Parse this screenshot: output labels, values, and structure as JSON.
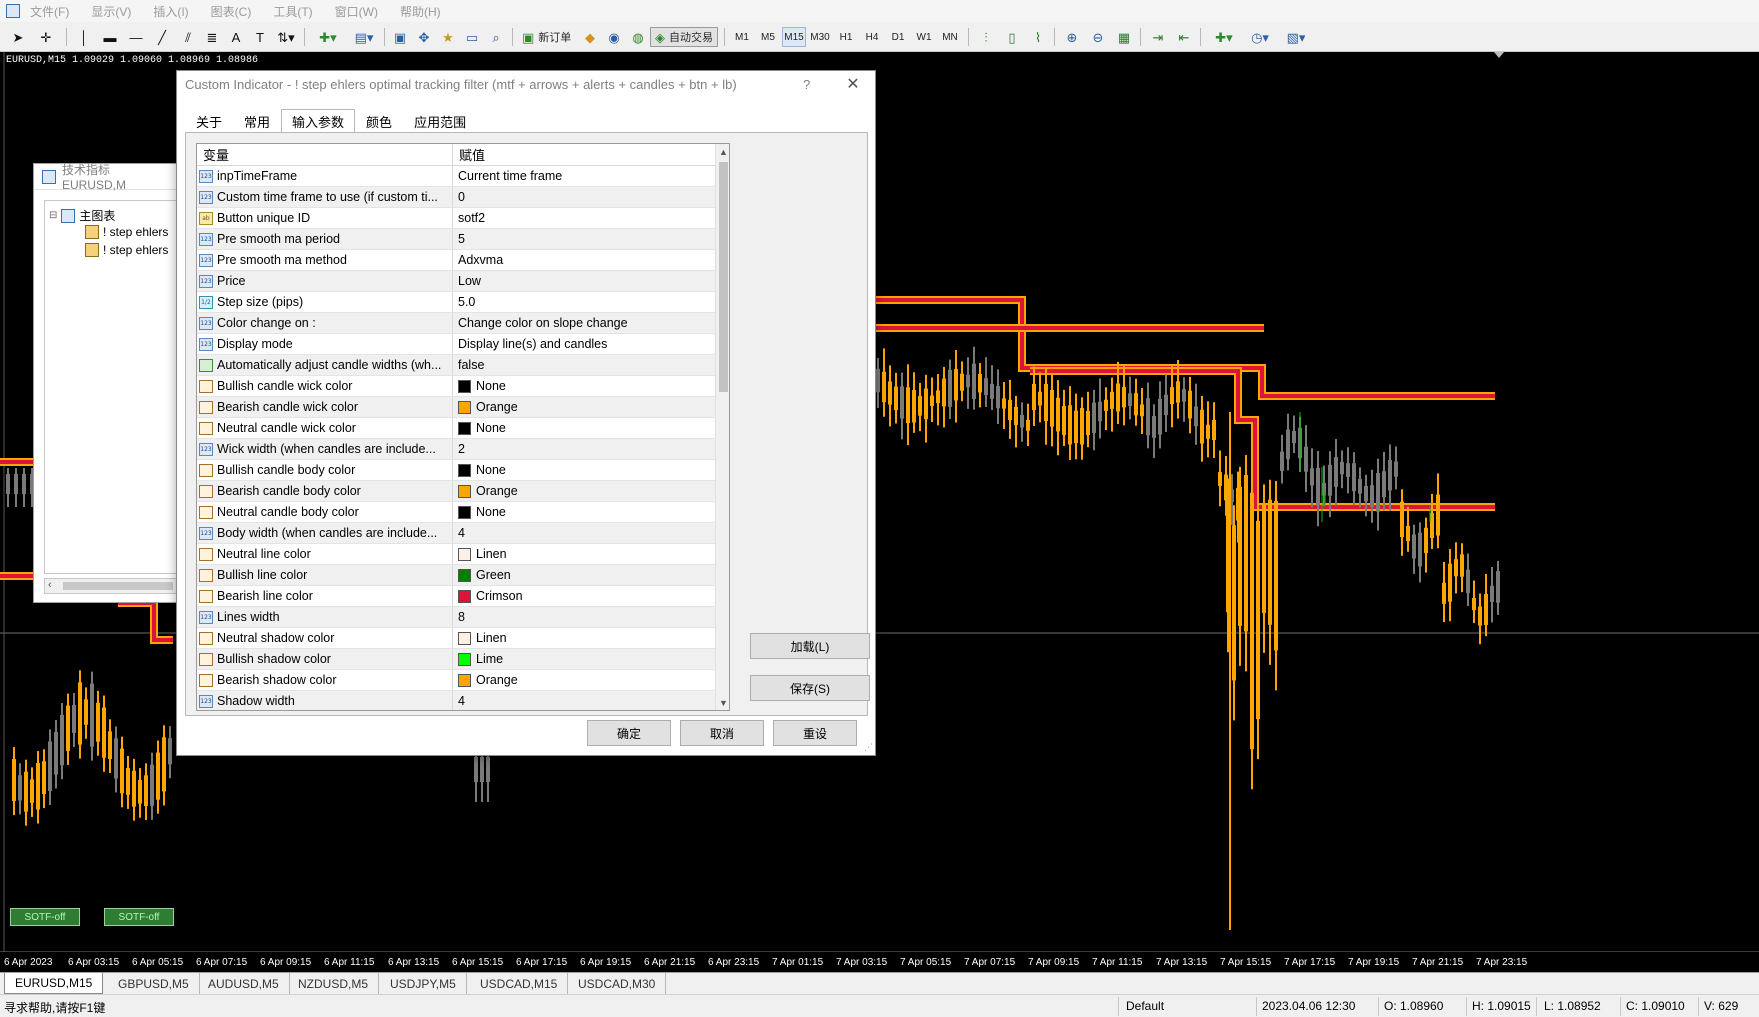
{
  "menu": [
    "文件(F)",
    "显示(V)",
    "插入(I)",
    "图表(C)",
    "工具(T)",
    "窗口(W)",
    "帮助(H)"
  ],
  "toolbar": {
    "new_order": "新订单",
    "auto_trading": "自动交易",
    "timeframes": [
      "M1",
      "M5",
      "M15",
      "M30",
      "H1",
      "H4",
      "D1",
      "W1",
      "MN"
    ],
    "active_timeframe": "M15"
  },
  "chart": {
    "symbol_info": "EURUSD,M15  1.09029 1.09060 1.08969 1.08986",
    "sotf_buttons": [
      "SOTF-off",
      "SOTF-off"
    ],
    "time_labels": [
      "6 Apr 2023",
      "6 Apr 03:15",
      "6 Apr 05:15",
      "6 Apr 07:15",
      "6 Apr 09:15",
      "6 Apr 11:15",
      "6 Apr 13:15",
      "6 Apr 15:15",
      "6 Apr 17:15",
      "6 Apr 19:15",
      "6 Apr 21:15",
      "6 Apr 23:15",
      "7 Apr 01:15",
      "7 Apr 03:15",
      "7 Apr 05:15",
      "7 Apr 07:15",
      "7 Apr 09:15",
      "7 Apr 11:15",
      "7 Apr 13:15",
      "7 Apr 15:15",
      "7 Apr 17:15",
      "7 Apr 19:15",
      "7 Apr 21:15",
      "7 Apr 23:15"
    ],
    "colors": {
      "background": "#000000",
      "bearish_candle": "#FFA500",
      "bullish_candle": "#000000",
      "neutral_candle": "#7a7a7a",
      "bullish_wick": "#00c000",
      "bearish_line": "#DC143C",
      "line_shadow": "#FFA500"
    }
  },
  "navigator": {
    "title": "技术指标 EURUSD,M",
    "root": "主图表",
    "items": [
      "! step ehlers",
      "! step ehlers"
    ]
  },
  "dialog": {
    "title": "Custom Indicator - ! step ehlers optimal tracking  filter (mtf + arrows + alerts + candles + btn + lb)",
    "help": "?",
    "tabs": [
      "关于",
      "常用",
      "输入参数",
      "颜色",
      "应用范围"
    ],
    "active_tab": "输入参数",
    "columns": [
      "变量",
      "赋值"
    ],
    "params": [
      {
        "type": "int",
        "name": "inpTimeFrame",
        "value": "Current time frame"
      },
      {
        "type": "int",
        "name": "Custom time frame to use (if custom ti...",
        "value": "0"
      },
      {
        "type": "string",
        "name": "Button unique ID",
        "value": "sotf2"
      },
      {
        "type": "int",
        "name": "Pre smooth ma period",
        "value": "5"
      },
      {
        "type": "int",
        "name": "Pre smooth ma method",
        "value": "Adxvma"
      },
      {
        "type": "int",
        "name": "Price",
        "value": "Low"
      },
      {
        "type": "double",
        "name": "Step size (pips)",
        "value": "5.0"
      },
      {
        "type": "int",
        "name": "Color change on :",
        "value": "Change color on slope change"
      },
      {
        "type": "int",
        "name": "Display mode",
        "value": "Display line(s) and candles"
      },
      {
        "type": "bool",
        "name": "Automatically adjust candle widths (wh...",
        "value": "false"
      },
      {
        "type": "color",
        "name": "Bullish candle wick color",
        "value": "None",
        "swatch": "#000000"
      },
      {
        "type": "color",
        "name": "Bearish candle wick color",
        "value": "Orange",
        "swatch": "#FFA500"
      },
      {
        "type": "color",
        "name": "Neutral candle wick color",
        "value": "None",
        "swatch": "#000000"
      },
      {
        "type": "int",
        "name": "Wick width (when candles are include...",
        "value": "2"
      },
      {
        "type": "color",
        "name": "Bullish candle body color",
        "value": "None",
        "swatch": "#000000"
      },
      {
        "type": "color",
        "name": "Bearish candle body color",
        "value": "Orange",
        "swatch": "#FFA500"
      },
      {
        "type": "color",
        "name": "Neutral candle body color",
        "value": "None",
        "swatch": "#000000"
      },
      {
        "type": "int",
        "name": "Body width (when candles are include...",
        "value": "4"
      },
      {
        "type": "color",
        "name": "Neutral line color",
        "value": "Linen",
        "swatch": "#FAF0E6"
      },
      {
        "type": "color",
        "name": "Bullish line color",
        "value": "Green",
        "swatch": "#008000"
      },
      {
        "type": "color",
        "name": "Bearish line color",
        "value": "Crimson",
        "swatch": "#DC143C"
      },
      {
        "type": "int",
        "name": "Lines width",
        "value": "8"
      },
      {
        "type": "color",
        "name": "Neutral shadow color",
        "value": "Linen",
        "swatch": "#FAF0E6"
      },
      {
        "type": "color",
        "name": "Bullish shadow color",
        "value": "Lime",
        "swatch": "#00FF00"
      },
      {
        "type": "color",
        "name": "Bearish shadow color",
        "value": "Orange",
        "swatch": "#FFA500"
      },
      {
        "type": "int",
        "name": "Shadow width",
        "value": "4"
      }
    ],
    "type_icons": {
      "int": "123",
      "string": "ab",
      "double": "1/2",
      "bool": "",
      "color": ""
    },
    "load_button": "加载(L)",
    "save_button": "保存(S)",
    "ok_button": "确定",
    "cancel_button": "取消",
    "reset_button": "重设"
  },
  "symbol_tabs": [
    "EURUSD,M15",
    "GBPUSD,M5",
    "AUDUSD,M5",
    "NZDUSD,M5",
    "USDJPY,M5",
    "USDCAD,M15",
    "USDCAD,M30"
  ],
  "active_symbol_tab": "EURUSD,M15",
  "status": {
    "help": "寻求帮助,请按F1键",
    "profile": "Default",
    "datetime": "2023.04.06 12:30",
    "open": "O: 1.08960",
    "high": "H: 1.09015",
    "low": "L: 1.08952",
    "close": "C: 1.09010",
    "volume": "V: 629"
  }
}
